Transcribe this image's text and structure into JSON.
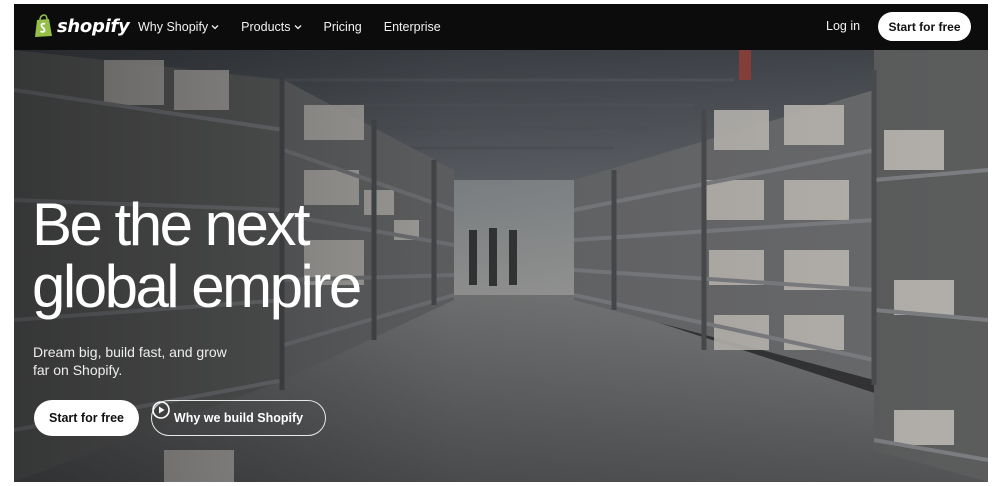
{
  "nav": {
    "logo_text": "shopify",
    "links": [
      {
        "label": "Why Shopify",
        "has_dropdown": true
      },
      {
        "label": "Products",
        "has_dropdown": true
      },
      {
        "label": "Pricing",
        "has_dropdown": false
      },
      {
        "label": "Enterprise",
        "has_dropdown": false
      }
    ],
    "login_label": "Log in",
    "cta_label": "Start for free"
  },
  "hero": {
    "headline_line1": "Be the next",
    "headline_line2": "global empire",
    "subtext": "Dream big, build fast, and grow far on Shopify.",
    "primary_button": "Start for free",
    "secondary_button": "Why we build Shopify",
    "background": "warehouse-aisle-image"
  },
  "icons": {
    "logo": "shopify-bag-icon",
    "dropdown": "chevron-down-icon",
    "play": "play-circle-icon"
  },
  "colors": {
    "nav_bg": "#0c0c0c",
    "button_bg": "#ffffff",
    "text_light": "#ffffff"
  }
}
